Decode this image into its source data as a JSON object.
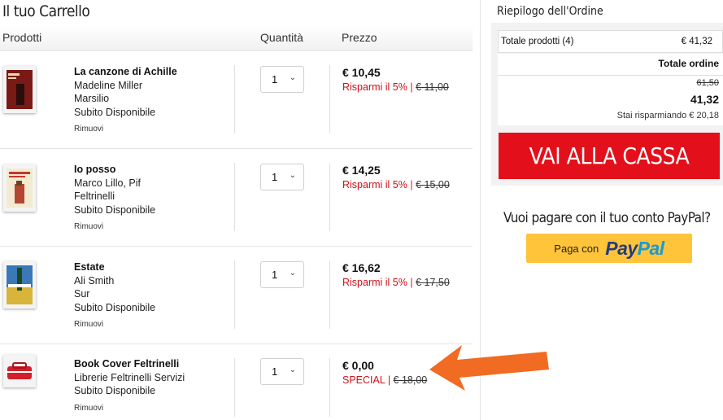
{
  "cart": {
    "title": "Il tuo Carrello",
    "columns": {
      "products": "Prodotti",
      "quantity": "Quantità",
      "price": "Prezzo"
    },
    "items": [
      {
        "title": "La canzone di Achille",
        "author": "Madeline Miller",
        "publisher": "Marsilio",
        "availability": "Subito Disponibile",
        "remove": "Rimuovi",
        "qty": "1",
        "price": "€ 10,45",
        "discount": "Risparmi il 5%",
        "sep": " | ",
        "old_price": "€ 11,00"
      },
      {
        "title": "Io posso",
        "author": "Marco Lillo, Pif",
        "publisher": "Feltrinelli",
        "availability": "Subito Disponibile",
        "remove": "Rimuovi",
        "qty": "1",
        "price": "€ 14,25",
        "discount": "Risparmi il 5%",
        "sep": " | ",
        "old_price": "€ 15,00"
      },
      {
        "title": "Estate",
        "author": "Ali Smith",
        "publisher": "Sur",
        "availability": "Subito Disponibile",
        "remove": "Rimuovi",
        "qty": "1",
        "price": "€ 16,62",
        "discount": "Risparmi il 5%",
        "sep": " | ",
        "old_price": "€ 17,50"
      },
      {
        "title": "Book Cover Feltrinelli",
        "author": "Librerie Feltrinelli Servizi",
        "availability": "Subito Disponibile",
        "remove": "Rimuovi",
        "qty": "1",
        "price": "€ 0,00",
        "discount": "SPECIAL",
        "sep": " | ",
        "old_price": "€ 18,00"
      }
    ]
  },
  "summary": {
    "title": "Riepilogo dell'Ordine",
    "products_label": "Totale prodotti (4)",
    "products_total": "€ 41,32",
    "order_total_label": "Totale ordine",
    "old_total": "61,50",
    "total": "41,32",
    "savings": "Stai risparmiando € 20,18",
    "checkout": "VAI ALLA CASSA"
  },
  "paypal": {
    "question": "Vuoi pagare con il tuo conto PayPal?",
    "pay_with": "Paga con",
    "brand_pay": "Pay",
    "brand_pal": "Pal"
  },
  "colors": {
    "accent": "#e3101b",
    "discount": "#d0101a",
    "paypal_yellow": "#ffc439",
    "arrow": "#f26b22"
  }
}
